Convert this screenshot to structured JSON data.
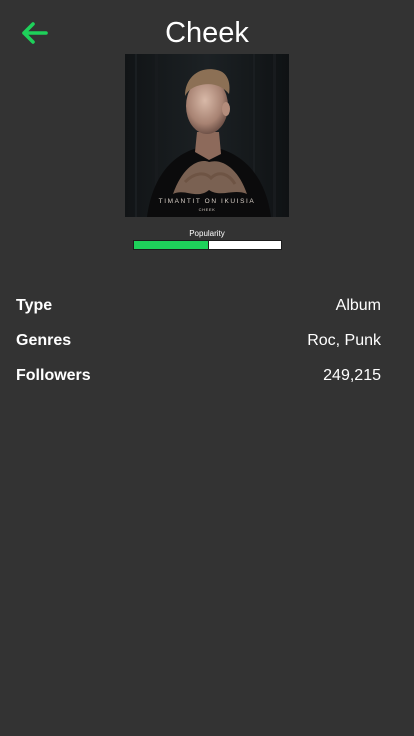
{
  "header": {
    "title": "Cheek",
    "back_icon": "arrow-left-icon"
  },
  "cover": {
    "album_title": "TIMANTIT ON IKUISIA",
    "artist_mark": "CHEEK"
  },
  "popularity": {
    "label": "Popularity",
    "value_fraction": 0.51
  },
  "details": [
    {
      "label": "Type",
      "value": "Album"
    },
    {
      "label": "Genres",
      "value": "Roc, Punk"
    },
    {
      "label": "Followers",
      "value": "249,215"
    }
  ],
  "colors": {
    "background": "#333333",
    "accent": "#1ed15a",
    "text": "#ffffff",
    "bar_empty": "#ffffff"
  }
}
